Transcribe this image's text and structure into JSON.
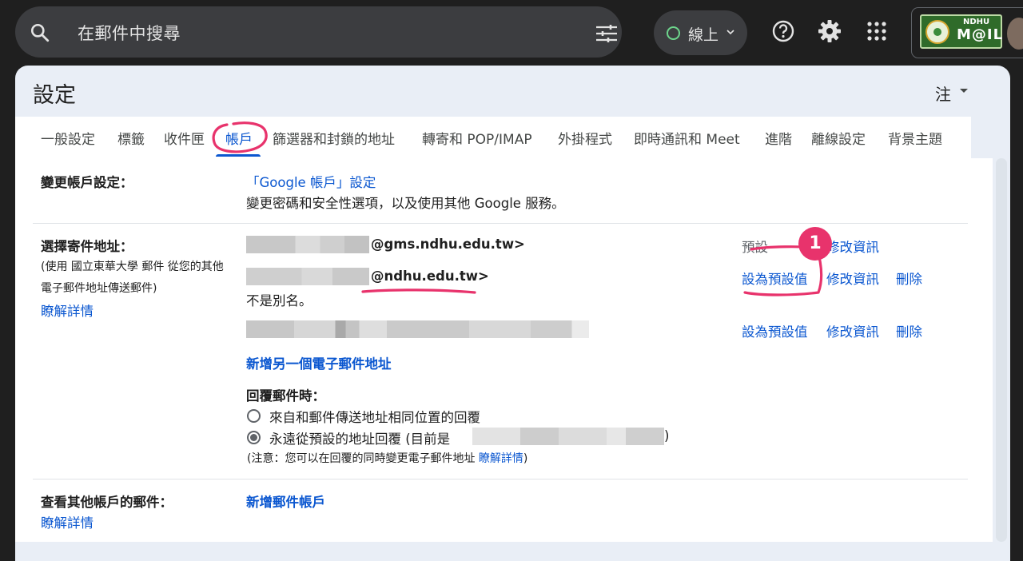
{
  "search": {
    "placeholder": "在郵件中搜尋"
  },
  "status": {
    "label": "線上"
  },
  "logo": {
    "line1": "NDHU",
    "line2": "M@IL"
  },
  "panel": {
    "title": "設定",
    "lang_label": "注"
  },
  "tabs": [
    {
      "label": "一般設定"
    },
    {
      "label": "標籤"
    },
    {
      "label": "收件匣"
    },
    {
      "label": "帳戶"
    },
    {
      "label": "篩選器和封鎖的地址"
    },
    {
      "label": "轉寄和 POP/IMAP"
    },
    {
      "label": "外掛程式"
    },
    {
      "label": "即時通訊和 Meet"
    },
    {
      "label": "進階"
    },
    {
      "label": "離線設定"
    },
    {
      "label": "背景主題"
    }
  ],
  "change_account": {
    "label": "變更帳戶設定：",
    "link": "「Google 帳戶」設定",
    "desc": "變更密碼和安全性選項，以及使用其他 Google 服務。"
  },
  "send_as": {
    "label": "選擇寄件地址：",
    "note_line1": "(使用 國立東華大學 郵件 從您的其他",
    "note_line2": "電子郵件地址傳送郵件)",
    "learn_more": "瞭解詳情",
    "addresses": [
      {
        "email_suffix": "@gms.ndhu.edu.tw>",
        "default": "預設",
        "edit": "修改資訊"
      },
      {
        "email_suffix": "@ndhu.edu.tw>",
        "set_default": "設為預設值",
        "edit": "修改資訊",
        "delete": "刪除",
        "alias_note": "不是別名。"
      },
      {
        "set_default": "設為預設值",
        "edit": "修改資訊",
        "delete": "刪除"
      }
    ],
    "add_address": "新增另一個電子郵件地址",
    "reply_label": "回覆郵件時：",
    "reply_option1": "來自和郵件傳送地址相同位置的回覆",
    "reply_option2_prefix": "永遠從預設的地址回覆 (目前是",
    "reply_option2_suffix": ")",
    "reply_note_prefix": "(注意：您可以在回覆的同時變更電子郵件地址 ",
    "reply_note_link": "瞭解詳情",
    "reply_note_suffix": ")"
  },
  "check_mail": {
    "label": "查看其他帳戶的郵件：",
    "learn_more": "瞭解詳情",
    "add_account": "新增郵件帳戶"
  },
  "annotation": {
    "badge": "1",
    "color": "#e8336c"
  },
  "colors": {
    "accent": "#0b57d0",
    "online": "#6dd58c",
    "topbar": "#1f1f1f",
    "panel": "#e9eef6"
  }
}
